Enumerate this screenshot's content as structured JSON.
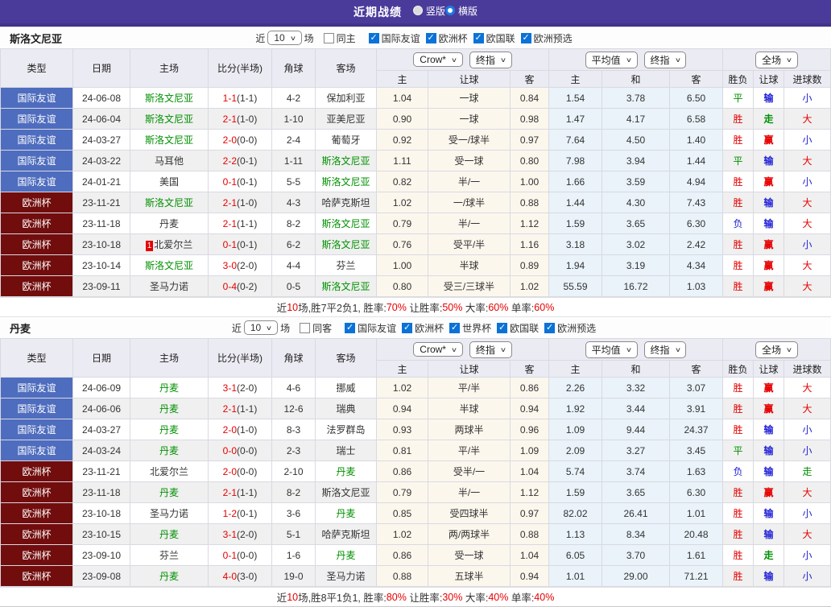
{
  "titlebar": {
    "title": "近期战绩",
    "radios": [
      {
        "label": "竖版",
        "selected": false
      },
      {
        "label": "横版",
        "selected": true
      }
    ],
    "accent_color": "#4a3b9b"
  },
  "filter_labels": {
    "near": "近",
    "games": "场"
  },
  "table_header": {
    "type": "类型",
    "date": "日期",
    "home": "主场",
    "score": "比分(半场)",
    "corners": "角球",
    "away": "客场",
    "odds_source_dropdown": "Crow*",
    "odds_time_dropdown": "终指",
    "odds_home": "主",
    "odds_handicap": "让球",
    "odds_away": "客",
    "avg_dropdown": "平均值",
    "avg_time_dropdown": "终指",
    "avg_home": "主",
    "avg_draw": "和",
    "avg_away": "客",
    "scope_dropdown": "全场",
    "result_wdl": "胜负",
    "result_handicap": "让球",
    "result_goals": "进球数"
  },
  "league_colors": {
    "国际友谊": "blue",
    "欧洲杯": "maroon"
  },
  "sections": [
    {
      "team": "斯洛文尼亚",
      "filter": {
        "count": "10",
        "same_side_label": "同主",
        "same_side_checked": false,
        "leagues": [
          "国际友谊",
          "欧洲杯",
          "欧国联",
          "欧洲预选"
        ]
      },
      "rows": [
        {
          "league": "国际友谊",
          "date": "24-06-08",
          "home": "斯洛文尼亚",
          "home_highlight": true,
          "home_redcards": "",
          "score": "1-1",
          "half": "(1-1)",
          "corners": "4-2",
          "away": "保加利亚",
          "away_highlight": false,
          "odds": [
            "1.04",
            "一球",
            "0.84"
          ],
          "avg": [
            "1.54",
            "3.78",
            "6.50"
          ],
          "results": [
            [
              "平",
              "green"
            ],
            [
              "输",
              "blue"
            ],
            [
              "小",
              "blue"
            ]
          ]
        },
        {
          "league": "国际友谊",
          "date": "24-06-04",
          "home": "斯洛文尼亚",
          "home_highlight": true,
          "home_redcards": "",
          "score": "2-1",
          "half": "(1-0)",
          "corners": "1-10",
          "away": "亚美尼亚",
          "away_highlight": false,
          "odds": [
            "0.90",
            "一球",
            "0.98"
          ],
          "avg": [
            "1.47",
            "4.17",
            "6.58"
          ],
          "results": [
            [
              "胜",
              "red"
            ],
            [
              "走",
              "green"
            ],
            [
              "大",
              "red"
            ]
          ]
        },
        {
          "league": "国际友谊",
          "date": "24-03-27",
          "home": "斯洛文尼亚",
          "home_highlight": true,
          "home_redcards": "",
          "score": "2-0",
          "half": "(0-0)",
          "corners": "2-4",
          "away": "葡萄牙",
          "away_highlight": false,
          "odds": [
            "0.92",
            "受一/球半",
            "0.97"
          ],
          "avg": [
            "7.64",
            "4.50",
            "1.40"
          ],
          "results": [
            [
              "胜",
              "red"
            ],
            [
              "赢",
              "red"
            ],
            [
              "小",
              "blue"
            ]
          ]
        },
        {
          "league": "国际友谊",
          "date": "24-03-22",
          "home": "马耳他",
          "home_highlight": false,
          "home_redcards": "",
          "score": "2-2",
          "half": "(0-1)",
          "corners": "1-11",
          "away": "斯洛文尼亚",
          "away_highlight": true,
          "odds": [
            "1.11",
            "受一球",
            "0.80"
          ],
          "avg": [
            "7.98",
            "3.94",
            "1.44"
          ],
          "results": [
            [
              "平",
              "green"
            ],
            [
              "输",
              "blue"
            ],
            [
              "大",
              "red"
            ]
          ]
        },
        {
          "league": "国际友谊",
          "date": "24-01-21",
          "home": "美国",
          "home_highlight": false,
          "home_redcards": "",
          "score": "0-1",
          "half": "(0-1)",
          "corners": "5-5",
          "away": "斯洛文尼亚",
          "away_highlight": true,
          "odds": [
            "0.82",
            "半/一",
            "1.00"
          ],
          "avg": [
            "1.66",
            "3.59",
            "4.94"
          ],
          "results": [
            [
              "胜",
              "red"
            ],
            [
              "赢",
              "red"
            ],
            [
              "小",
              "blue"
            ]
          ]
        },
        {
          "league": "欧洲杯",
          "date": "23-11-21",
          "home": "斯洛文尼亚",
          "home_highlight": true,
          "home_redcards": "",
          "score": "2-1",
          "half": "(1-0)",
          "corners": "4-3",
          "away": "哈萨克斯坦",
          "away_highlight": false,
          "odds": [
            "1.02",
            "一/球半",
            "0.88"
          ],
          "avg": [
            "1.44",
            "4.30",
            "7.43"
          ],
          "results": [
            [
              "胜",
              "red"
            ],
            [
              "输",
              "blue"
            ],
            [
              "大",
              "red"
            ]
          ]
        },
        {
          "league": "欧洲杯",
          "date": "23-11-18",
          "home": "丹麦",
          "home_highlight": false,
          "home_redcards": "",
          "score": "2-1",
          "half": "(1-1)",
          "corners": "8-2",
          "away": "斯洛文尼亚",
          "away_highlight": true,
          "odds": [
            "0.79",
            "半/一",
            "1.12"
          ],
          "avg": [
            "1.59",
            "3.65",
            "6.30"
          ],
          "results": [
            [
              "负",
              "blue"
            ],
            [
              "输",
              "blue"
            ],
            [
              "大",
              "red"
            ]
          ]
        },
        {
          "league": "欧洲杯",
          "date": "23-10-18",
          "home": "北爱尔兰",
          "home_highlight": false,
          "home_redcards": "1",
          "score": "0-1",
          "half": "(0-1)",
          "corners": "6-2",
          "away": "斯洛文尼亚",
          "away_highlight": true,
          "odds": [
            "0.76",
            "受平/半",
            "1.16"
          ],
          "avg": [
            "3.18",
            "3.02",
            "2.42"
          ],
          "results": [
            [
              "胜",
              "red"
            ],
            [
              "赢",
              "red"
            ],
            [
              "小",
              "blue"
            ]
          ]
        },
        {
          "league": "欧洲杯",
          "date": "23-10-14",
          "home": "斯洛文尼亚",
          "home_highlight": true,
          "home_redcards": "",
          "score": "3-0",
          "half": "(2-0)",
          "corners": "4-4",
          "away": "芬兰",
          "away_highlight": false,
          "odds": [
            "1.00",
            "半球",
            "0.89"
          ],
          "avg": [
            "1.94",
            "3.19",
            "4.34"
          ],
          "results": [
            [
              "胜",
              "red"
            ],
            [
              "赢",
              "red"
            ],
            [
              "大",
              "red"
            ]
          ]
        },
        {
          "league": "欧洲杯",
          "date": "23-09-11",
          "home": "圣马力诺",
          "home_highlight": false,
          "home_redcards": "",
          "score": "0-4",
          "half": "(0-2)",
          "corners": "0-5",
          "away": "斯洛文尼亚",
          "away_highlight": true,
          "odds": [
            "0.80",
            "受三/三球半",
            "1.02"
          ],
          "avg": [
            "55.59",
            "16.72",
            "1.03"
          ],
          "results": [
            [
              "胜",
              "red"
            ],
            [
              "赢",
              "red"
            ],
            [
              "大",
              "red"
            ]
          ]
        }
      ],
      "summary": [
        [
          "近",
          "dark"
        ],
        [
          "10",
          "red"
        ],
        [
          "场,胜7平2负1, 胜率:",
          "dark"
        ],
        [
          "70%",
          "red"
        ],
        [
          " 让胜率:",
          "dark"
        ],
        [
          "50%",
          "red"
        ],
        [
          " 大率:",
          "dark"
        ],
        [
          "60%",
          "red"
        ],
        [
          " 单率:",
          "dark"
        ],
        [
          "60%",
          "red"
        ]
      ]
    },
    {
      "team": "丹麦",
      "filter": {
        "count": "10",
        "same_side_label": "同客",
        "same_side_checked": false,
        "leagues": [
          "国际友谊",
          "欧洲杯",
          "世界杯",
          "欧国联",
          "欧洲预选"
        ]
      },
      "rows": [
        {
          "league": "国际友谊",
          "date": "24-06-09",
          "home": "丹麦",
          "home_highlight": true,
          "home_redcards": "",
          "score": "3-1",
          "half": "(2-0)",
          "corners": "4-6",
          "away": "挪威",
          "away_highlight": false,
          "odds": [
            "1.02",
            "平/半",
            "0.86"
          ],
          "avg": [
            "2.26",
            "3.32",
            "3.07"
          ],
          "results": [
            [
              "胜",
              "red"
            ],
            [
              "赢",
              "red"
            ],
            [
              "大",
              "red"
            ]
          ]
        },
        {
          "league": "国际友谊",
          "date": "24-06-06",
          "home": "丹麦",
          "home_highlight": true,
          "home_redcards": "",
          "score": "2-1",
          "half": "(1-1)",
          "corners": "12-6",
          "away": "瑞典",
          "away_highlight": false,
          "odds": [
            "0.94",
            "半球",
            "0.94"
          ],
          "avg": [
            "1.92",
            "3.44",
            "3.91"
          ],
          "results": [
            [
              "胜",
              "red"
            ],
            [
              "赢",
              "red"
            ],
            [
              "大",
              "red"
            ]
          ]
        },
        {
          "league": "国际友谊",
          "date": "24-03-27",
          "home": "丹麦",
          "home_highlight": true,
          "home_redcards": "",
          "score": "2-0",
          "half": "(1-0)",
          "corners": "8-3",
          "away": "法罗群岛",
          "away_highlight": false,
          "odds": [
            "0.93",
            "两球半",
            "0.96"
          ],
          "avg": [
            "1.09",
            "9.44",
            "24.37"
          ],
          "results": [
            [
              "胜",
              "red"
            ],
            [
              "输",
              "blue"
            ],
            [
              "小",
              "blue"
            ]
          ]
        },
        {
          "league": "国际友谊",
          "date": "24-03-24",
          "home": "丹麦",
          "home_highlight": true,
          "home_redcards": "",
          "score": "0-0",
          "half": "(0-0)",
          "corners": "2-3",
          "away": "瑞士",
          "away_highlight": false,
          "odds": [
            "0.81",
            "平/半",
            "1.09"
          ],
          "avg": [
            "2.09",
            "3.27",
            "3.45"
          ],
          "results": [
            [
              "平",
              "green"
            ],
            [
              "输",
              "blue"
            ],
            [
              "小",
              "blue"
            ]
          ]
        },
        {
          "league": "欧洲杯",
          "date": "23-11-21",
          "home": "北爱尔兰",
          "home_highlight": false,
          "home_redcards": "",
          "score": "2-0",
          "half": "(0-0)",
          "corners": "2-10",
          "away": "丹麦",
          "away_highlight": true,
          "odds": [
            "0.86",
            "受半/一",
            "1.04"
          ],
          "avg": [
            "5.74",
            "3.74",
            "1.63"
          ],
          "results": [
            [
              "负",
              "blue"
            ],
            [
              "输",
              "blue"
            ],
            [
              "走",
              "green"
            ]
          ]
        },
        {
          "league": "欧洲杯",
          "date": "23-11-18",
          "home": "丹麦",
          "home_highlight": true,
          "home_redcards": "",
          "score": "2-1",
          "half": "(1-1)",
          "corners": "8-2",
          "away": "斯洛文尼亚",
          "away_highlight": false,
          "odds": [
            "0.79",
            "半/一",
            "1.12"
          ],
          "avg": [
            "1.59",
            "3.65",
            "6.30"
          ],
          "results": [
            [
              "胜",
              "red"
            ],
            [
              "赢",
              "red"
            ],
            [
              "大",
              "red"
            ]
          ]
        },
        {
          "league": "欧洲杯",
          "date": "23-10-18",
          "home": "圣马力诺",
          "home_highlight": false,
          "home_redcards": "",
          "score": "1-2",
          "half": "(0-1)",
          "corners": "3-6",
          "away": "丹麦",
          "away_highlight": true,
          "odds": [
            "0.85",
            "受四球半",
            "0.97"
          ],
          "avg": [
            "82.02",
            "26.41",
            "1.01"
          ],
          "results": [
            [
              "胜",
              "red"
            ],
            [
              "输",
              "blue"
            ],
            [
              "小",
              "blue"
            ]
          ]
        },
        {
          "league": "欧洲杯",
          "date": "23-10-15",
          "home": "丹麦",
          "home_highlight": true,
          "home_redcards": "",
          "score": "3-1",
          "half": "(2-0)",
          "corners": "5-1",
          "away": "哈萨克斯坦",
          "away_highlight": false,
          "odds": [
            "1.02",
            "两/两球半",
            "0.88"
          ],
          "avg": [
            "1.13",
            "8.34",
            "20.48"
          ],
          "results": [
            [
              "胜",
              "red"
            ],
            [
              "输",
              "blue"
            ],
            [
              "大",
              "red"
            ]
          ]
        },
        {
          "league": "欧洲杯",
          "date": "23-09-10",
          "home": "芬兰",
          "home_highlight": false,
          "home_redcards": "",
          "score": "0-1",
          "half": "(0-0)",
          "corners": "1-6",
          "away": "丹麦",
          "away_highlight": true,
          "odds": [
            "0.86",
            "受一球",
            "1.04"
          ],
          "avg": [
            "6.05",
            "3.70",
            "1.61"
          ],
          "results": [
            [
              "胜",
              "red"
            ],
            [
              "走",
              "green"
            ],
            [
              "小",
              "blue"
            ]
          ]
        },
        {
          "league": "欧洲杯",
          "date": "23-09-08",
          "home": "丹麦",
          "home_highlight": true,
          "home_redcards": "",
          "score": "4-0",
          "half": "(3-0)",
          "corners": "19-0",
          "away": "圣马力诺",
          "away_highlight": false,
          "odds": [
            "0.88",
            "五球半",
            "0.94"
          ],
          "avg": [
            "1.01",
            "29.00",
            "71.21"
          ],
          "results": [
            [
              "胜",
              "red"
            ],
            [
              "输",
              "blue"
            ],
            [
              "小",
              "blue"
            ]
          ]
        }
      ],
      "summary": [
        [
          "近",
          "dark"
        ],
        [
          "10",
          "red"
        ],
        [
          "场,胜8平1负1, 胜率:",
          "dark"
        ],
        [
          "80%",
          "red"
        ],
        [
          " 让胜率:",
          "dark"
        ],
        [
          "30%",
          "red"
        ],
        [
          " 大率:",
          "dark"
        ],
        [
          "40%",
          "red"
        ],
        [
          " 单率:",
          "dark"
        ],
        [
          "40%",
          "red"
        ]
      ]
    }
  ]
}
